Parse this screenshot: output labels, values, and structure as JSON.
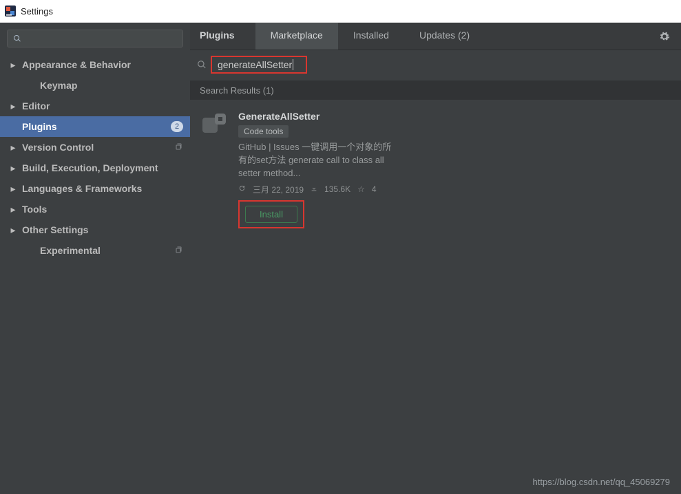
{
  "window": {
    "title": "Settings"
  },
  "sidebar": {
    "items": [
      {
        "label": "Appearance & Behavior",
        "expandable": true,
        "bold": true
      },
      {
        "label": "Keymap",
        "expandable": false,
        "bold": true
      },
      {
        "label": "Editor",
        "expandable": true,
        "bold": true
      },
      {
        "label": "Plugins",
        "expandable": false,
        "bold": true,
        "selected": true,
        "badge": "2"
      },
      {
        "label": "Version Control",
        "expandable": true,
        "bold": true,
        "copy": true
      },
      {
        "label": "Build, Execution, Deployment",
        "expandable": true,
        "bold": true
      },
      {
        "label": "Languages & Frameworks",
        "expandable": true,
        "bold": true
      },
      {
        "label": "Tools",
        "expandable": true,
        "bold": true
      },
      {
        "label": "Other Settings",
        "expandable": true,
        "bold": true
      },
      {
        "label": "Experimental",
        "expandable": false,
        "bold": true,
        "copy": true
      }
    ]
  },
  "tabs": {
    "heading": "Plugins",
    "items": [
      {
        "label": "Marketplace",
        "active": true
      },
      {
        "label": "Installed"
      },
      {
        "label": "Updates (2)"
      }
    ]
  },
  "search": {
    "value": "generateAllSetter"
  },
  "results": {
    "header": "Search Results (1)",
    "items": [
      {
        "name": "GenerateAllSetter",
        "tag": "Code tools",
        "description": "GitHub | Issues 一键调用一个对象的所有的set方法 generate call to class all setter method...",
        "date": "三月 22, 2019",
        "downloads": "135.6K",
        "rating": "4",
        "install_label": "Install"
      }
    ]
  },
  "watermark": "https://blog.csdn.net/qq_45069279"
}
